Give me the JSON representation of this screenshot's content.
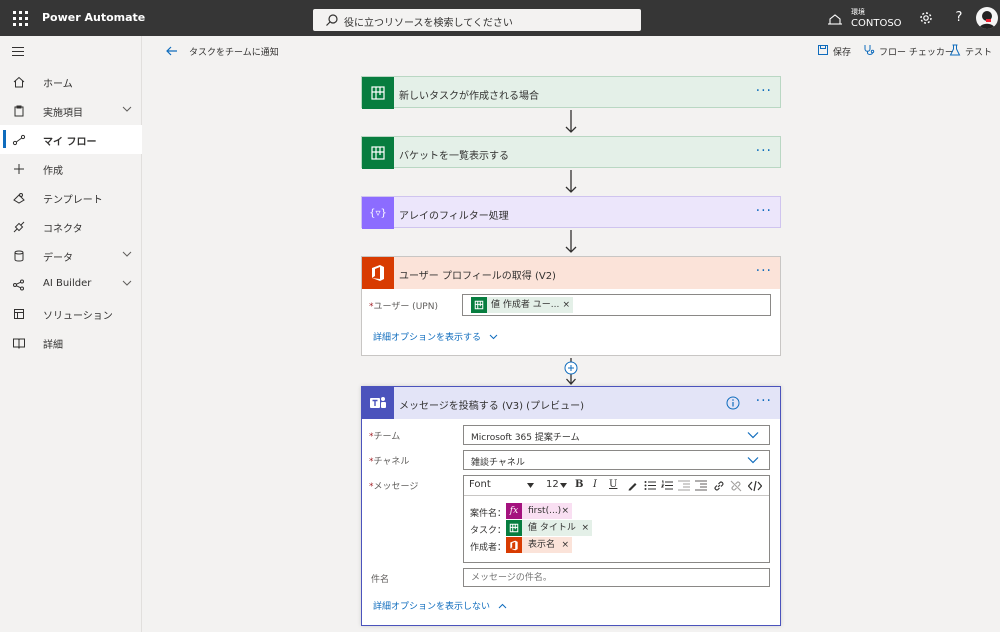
{
  "topbar": {
    "app_title": "Power Automate",
    "search_placeholder": "役に立つリソースを検索してください",
    "env_label": "環境",
    "env_name": "CONTOSO",
    "help": "?"
  },
  "sidebar": {
    "items": [
      {
        "label": "ホーム",
        "icon": "home-icon"
      },
      {
        "label": "実施項目",
        "icon": "clipboard-icon"
      },
      {
        "label": "マイ フロー",
        "icon": "flow-icon"
      },
      {
        "label": "作成",
        "icon": "plus-icon"
      },
      {
        "label": "テンプレート",
        "icon": "template-icon"
      },
      {
        "label": "コネクタ",
        "icon": "connector-icon"
      },
      {
        "label": "データ",
        "icon": "database-icon"
      },
      {
        "label": "AI Builder",
        "icon": "ai-builder-icon"
      },
      {
        "label": "ソリューション",
        "icon": "solution-icon"
      },
      {
        "label": "詳細",
        "icon": "book-icon"
      }
    ]
  },
  "commandbar": {
    "breadcrumb": "タスクをチームに通知",
    "save": "保存",
    "flow_checker": "フロー チェッカー",
    "test": "テスト"
  },
  "steps": {
    "s1": {
      "title": "新しいタスクが作成される場合",
      "color": "#077d3f"
    },
    "s2": {
      "title": "バケットを一覧表示する",
      "color": "#077d3f"
    },
    "s3": {
      "title": "アレイのフィルター処理",
      "color": "#8c6cff",
      "icon_text": "{▿}"
    },
    "s4": {
      "title": "ユーザー プロフィールの取得 (V2)",
      "color": "#d83b01",
      "user_label": "ユーザー (UPN)",
      "user_token": "値 作成者 ユー...",
      "advanced_link": "詳細オプションを表示する"
    },
    "s5": {
      "title": "メッセージを投稿する (V3) (プレビュー)",
      "color": "#4b53bc",
      "team_label": "チーム",
      "team_value": "Microsoft 365 提案チーム",
      "channel_label": "チャネル",
      "channel_value": "雑談チャネル",
      "message_label": "メッセージ",
      "font_name": "Font",
      "font_size": "12",
      "lines": {
        "l1_label": "案件名：",
        "l1_token": "first(...)",
        "l1_icon": "fx",
        "l2_label": "タスク：",
        "l2_token": "値 タイトル",
        "l3_label": "作成者：",
        "l3_token": "表示名"
      },
      "subject_label": "件名",
      "subject_placeholder": "メッセージの件名。",
      "hide_link": "詳細オプションを表示しない"
    }
  },
  "token_x": "×",
  "required_mark": "*",
  "more": "···"
}
